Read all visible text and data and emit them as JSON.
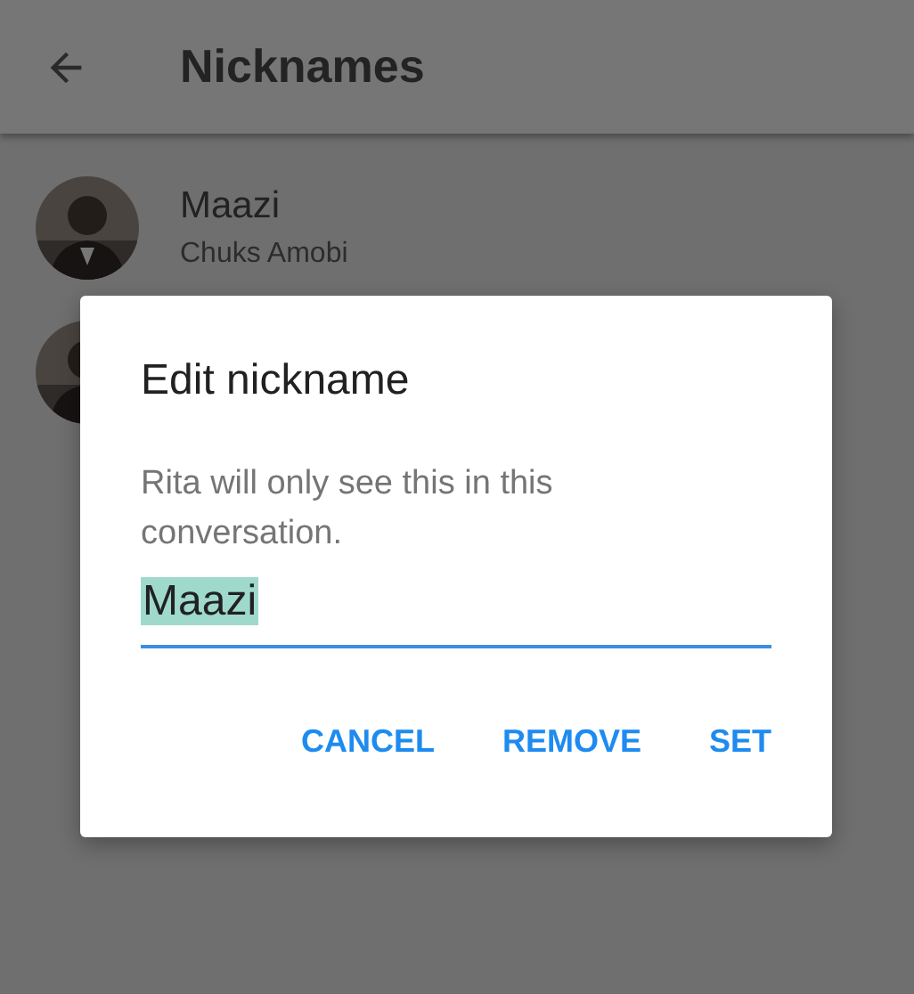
{
  "header": {
    "title": "Nicknames"
  },
  "contacts": [
    {
      "kind": "contact",
      "nickname": "Maazi",
      "name": "Chuks Amobi"
    },
    {
      "kind": "hidden"
    }
  ],
  "dialog": {
    "title": "Edit nickname",
    "message": "Rita will only see this in this conversation.",
    "input": {
      "value": "Maazi",
      "selected": true
    },
    "buttons": [
      "CANCEL",
      "REMOVE",
      "SET"
    ]
  }
}
